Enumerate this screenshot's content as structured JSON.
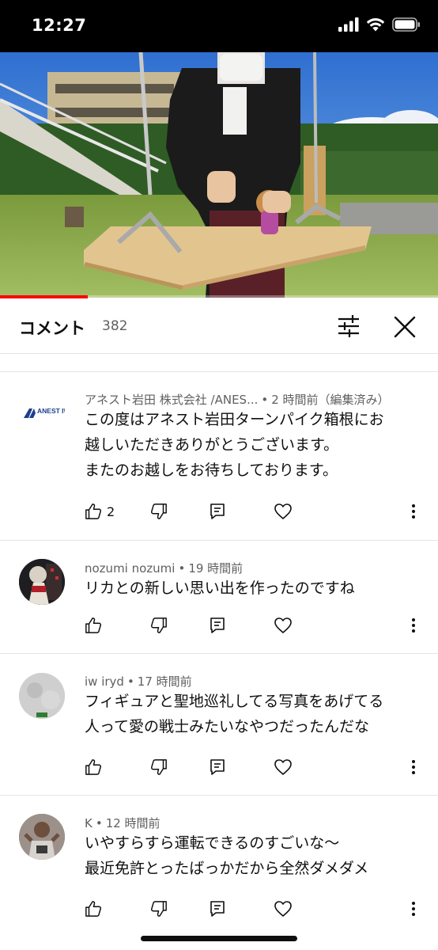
{
  "status_bar": {
    "time": "12:27"
  },
  "video": {
    "progress_fraction": 0.2
  },
  "comments_header": {
    "title": "コメント",
    "count": "382"
  },
  "icons": {
    "filter": "sliders-icon",
    "close": "close-icon",
    "like": "thumb-up-icon",
    "dislike": "thumb-down-icon",
    "reply": "reply-icon",
    "heart": "heart-icon",
    "more": "more-vert-icon"
  },
  "comments": [
    {
      "author": "アネスト岩田 株式会社 /ANES...",
      "time": "2 時間前（編集済み）",
      "lines": [
        "この度はアネスト岩田ターンパイク箱根にお",
        "越しいただきありがとうございます。",
        "またのお越しをお待ちしております。"
      ],
      "likes": "2",
      "avatar_text": "ANEST IWATA"
    },
    {
      "author": "nozumi nozumi",
      "time": "19 時間前",
      "lines": [
        "リカとの新しい思い出を作ったのですね"
      ],
      "likes": ""
    },
    {
      "author": "iw iryd",
      "time": "17 時間前",
      "lines": [
        "フィギュアと聖地巡礼してる写真をあげてる",
        "人って愛の戦士みたいなやつだったんだな"
      ],
      "likes": ""
    },
    {
      "author": "K",
      "time": "12 時間前",
      "lines": [
        "いやすらすら運転できるのすごいな〜",
        "最近免許とったばっかだから全然ダメダメ"
      ],
      "likes": ""
    }
  ]
}
